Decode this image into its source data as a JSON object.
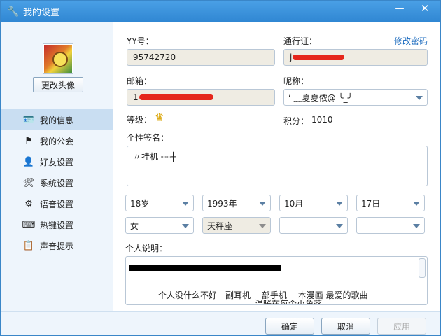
{
  "window": {
    "title": "我的设置",
    "title_icon": "wrench-icon",
    "minimize": "—",
    "close": "✕"
  },
  "sidebar": {
    "change_avatar": "更改头像",
    "items": [
      {
        "label": "我的信息",
        "icon": "id-card-icon",
        "active": true
      },
      {
        "label": "我的公会",
        "icon": "flag-icon",
        "active": false
      },
      {
        "label": "好友设置",
        "icon": "user-icon",
        "active": false
      },
      {
        "label": "系统设置",
        "icon": "tools-icon",
        "active": false
      },
      {
        "label": "语音设置",
        "icon": "voice-gear-icon",
        "active": false
      },
      {
        "label": "热键设置",
        "icon": "hotkey-icon",
        "active": false
      },
      {
        "label": "声音提示",
        "icon": "sound-prompt-icon",
        "active": false
      }
    ]
  },
  "form": {
    "yy_label": "YY号：",
    "yy_value": "95742720",
    "passport_label": "通行证：",
    "passport_prefix": "j",
    "change_password": "修改密码",
    "email_label": "邮箱：",
    "email_prefix": "1",
    "nickname_label": "昵称：",
    "nickname_value": "ʻ ﹏夏夏侬@ ╰_╯",
    "level_label": "等级：",
    "level_icon": "crown-icon",
    "points_label": "积分：",
    "points_value": "1010",
    "signature_label": "个性签名：",
    "signature_value": "〃挂机 ┈┈╂",
    "age": "18岁",
    "year": "1993年",
    "month": "10月",
    "day": "17日",
    "gender": "女",
    "zodiac": "天秤座",
    "blank1": "",
    "blank2": "",
    "desc_label": "个人说明：",
    "desc_line1": "一个人没什么不好一副耳机 一部手机 一本漫画 最爱的歌曲",
    "desc_line2": "温暖在每个小角落"
  },
  "footer": {
    "ok": "确定",
    "cancel": "取消",
    "apply": "应用"
  },
  "colors": {
    "accent": "#2f86d2",
    "redaction": "#e5261c",
    "link": "#1b6bbf"
  }
}
